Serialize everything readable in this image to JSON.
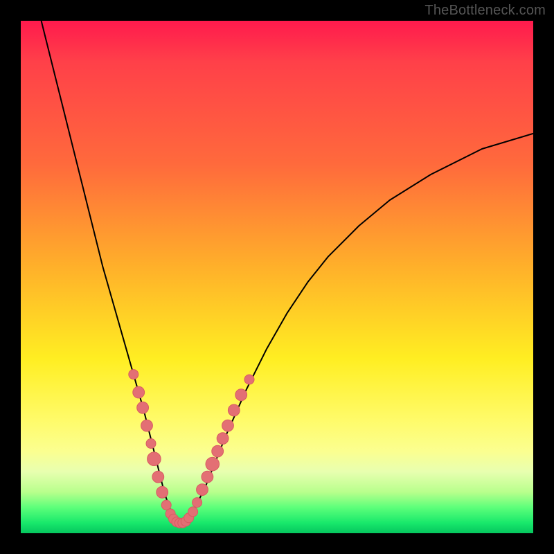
{
  "watermark": "TheBottleneck.com",
  "colors": {
    "frame": "#000000",
    "curve": "#000000",
    "dot_fill": "#e36f74",
    "dot_stroke": "#d85b62",
    "gradient_stops": [
      "#ff1a4d",
      "#ff4049",
      "#ff6a3c",
      "#ffb02a",
      "#ffee22",
      "#fffb6a",
      "#fbff90",
      "#e8ffb0",
      "#b8ff8c",
      "#5cff7a",
      "#18e86b",
      "#05c65e"
    ]
  },
  "chart_data": {
    "type": "line",
    "title": "",
    "xlabel": "",
    "ylabel": "",
    "xlim": [
      0,
      100
    ],
    "ylim": [
      0,
      100
    ],
    "grid": false,
    "legend": false,
    "series": [
      {
        "name": "bottleneck-curve",
        "x": [
          4,
          6,
          8,
          10,
          12,
          14,
          16,
          18,
          20,
          22,
          24,
          25,
          26,
          27,
          28,
          29,
          30,
          31,
          32,
          33,
          34,
          36,
          38,
          40,
          44,
          48,
          52,
          56,
          60,
          66,
          72,
          80,
          90,
          100
        ],
        "y": [
          100,
          92,
          84,
          76,
          68,
          60,
          52,
          45,
          38,
          31,
          24,
          20,
          16,
          12,
          8,
          5,
          3,
          2,
          2,
          3,
          5,
          9,
          14,
          19,
          28,
          36,
          43,
          49,
          54,
          60,
          65,
          70,
          75,
          78
        ]
      }
    ],
    "markers": [
      {
        "x": 22.0,
        "y": 31.0,
        "r": 1.0
      },
      {
        "x": 23.0,
        "y": 27.5,
        "r": 1.2
      },
      {
        "x": 23.8,
        "y": 24.5,
        "r": 1.2
      },
      {
        "x": 24.6,
        "y": 21.0,
        "r": 1.2
      },
      {
        "x": 25.4,
        "y": 17.5,
        "r": 1.0
      },
      {
        "x": 26.0,
        "y": 14.5,
        "r": 1.4
      },
      {
        "x": 26.8,
        "y": 11.0,
        "r": 1.2
      },
      {
        "x": 27.6,
        "y": 8.0,
        "r": 1.2
      },
      {
        "x": 28.4,
        "y": 5.5,
        "r": 1.0
      },
      {
        "x": 29.2,
        "y": 3.8,
        "r": 1.0
      },
      {
        "x": 29.8,
        "y": 2.8,
        "r": 1.0
      },
      {
        "x": 30.4,
        "y": 2.2,
        "r": 1.0
      },
      {
        "x": 31.0,
        "y": 2.0,
        "r": 1.0
      },
      {
        "x": 31.6,
        "y": 2.0,
        "r": 1.0
      },
      {
        "x": 32.2,
        "y": 2.3,
        "r": 1.0
      },
      {
        "x": 32.8,
        "y": 3.0,
        "r": 1.0
      },
      {
        "x": 33.6,
        "y": 4.2,
        "r": 1.0
      },
      {
        "x": 34.4,
        "y": 6.0,
        "r": 1.0
      },
      {
        "x": 35.4,
        "y": 8.5,
        "r": 1.2
      },
      {
        "x": 36.4,
        "y": 11.0,
        "r": 1.2
      },
      {
        "x": 37.4,
        "y": 13.5,
        "r": 1.4
      },
      {
        "x": 38.4,
        "y": 16.0,
        "r": 1.2
      },
      {
        "x": 39.4,
        "y": 18.5,
        "r": 1.2
      },
      {
        "x": 40.4,
        "y": 21.0,
        "r": 1.2
      },
      {
        "x": 41.6,
        "y": 24.0,
        "r": 1.2
      },
      {
        "x": 43.0,
        "y": 27.0,
        "r": 1.2
      },
      {
        "x": 44.6,
        "y": 30.0,
        "r": 1.0
      }
    ],
    "annotations": []
  }
}
